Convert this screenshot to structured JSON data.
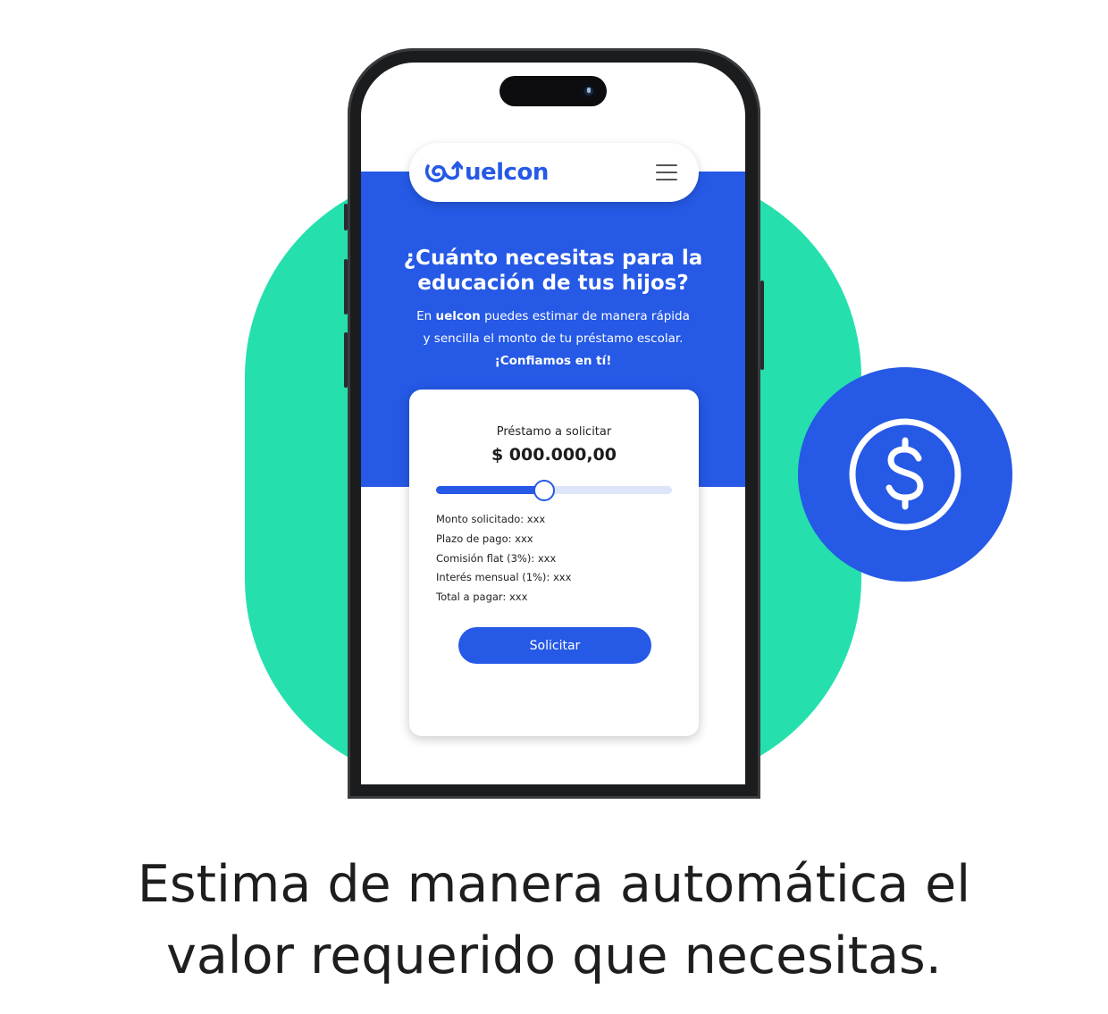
{
  "app": {
    "brand": "uelcon"
  },
  "hero": {
    "title_line1": "¿Cuánto necesitas para la",
    "title_line2": "educación de tus hijos?",
    "desc_part1": "En ",
    "desc_brand": "uelcon",
    "desc_part2": " puedes estimar de manera rápida y sencilla el monto de tu préstamo escolar. ",
    "desc_highlight": "¡Confiamos en tí!"
  },
  "calculator": {
    "label": "Préstamo a solicitar",
    "amount": "$ 000.000,00",
    "slider_fraction": 0.46,
    "details": [
      "Monto solicitado: xxx",
      "Plazo de pago: xxx",
      "Comisión flat (3%): xxx",
      "Interés mensual (1%): xxx",
      "Total a pagar: xxx"
    ],
    "submit_label": "Solicitar"
  },
  "caption": {
    "line1": "Estima de manera automática el",
    "line2": "valor requerido que necesitas."
  },
  "colors": {
    "brand_blue": "#2559e6",
    "mint": "#25e0ad",
    "phone_frame": "#1b1c1e"
  },
  "icons": {
    "badge": "dollar-circle-icon",
    "menu": "hamburger-menu-icon",
    "logo": "uelcon-logo-icon"
  }
}
